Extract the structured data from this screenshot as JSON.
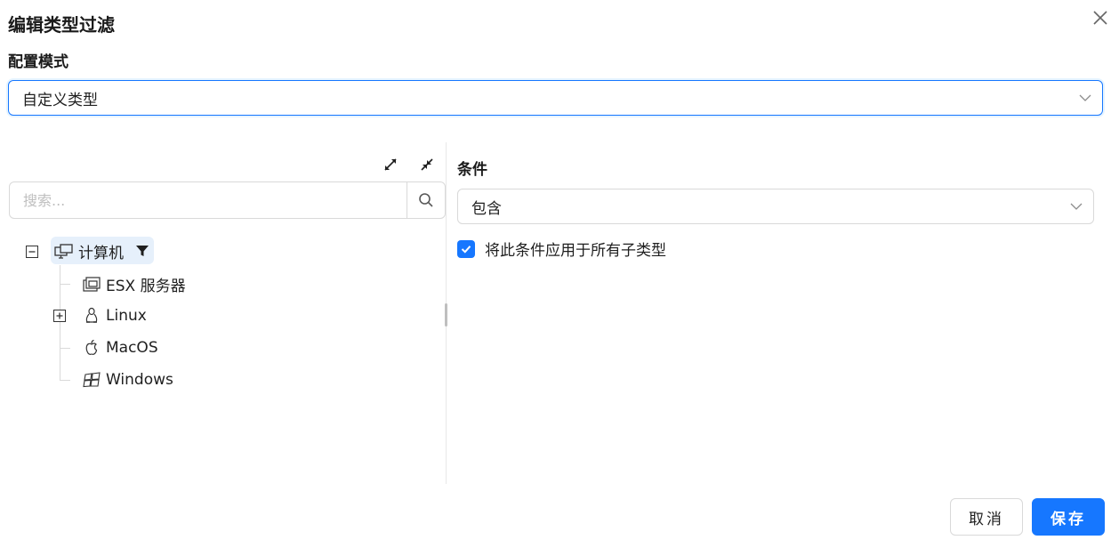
{
  "dialog": {
    "title": "编辑类型过滤"
  },
  "config": {
    "label": "配置模式",
    "mode_value": "自定义类型"
  },
  "search": {
    "placeholder": "搜索..."
  },
  "tree": {
    "root": {
      "label": "计算机",
      "icon": "computer-icon",
      "filter_icon": "filter-icon"
    },
    "children": [
      {
        "label": "ESX 服务器",
        "icon": "server-icon"
      },
      {
        "label": "Linux",
        "icon": "linux-icon"
      },
      {
        "label": "MacOS",
        "icon": "apple-icon"
      },
      {
        "label": "Windows",
        "icon": "windows-icon"
      }
    ]
  },
  "condition": {
    "label": "条件",
    "value": "包含",
    "apply_to_children_label": "将此条件应用于所有子类型",
    "apply_to_children_checked": true
  },
  "footer": {
    "cancel_label": "取消",
    "save_label": "保存"
  },
  "colors": {
    "primary": "#1677ff",
    "selected_bg": "#e6f0fb",
    "border": "#d9d9d9"
  }
}
